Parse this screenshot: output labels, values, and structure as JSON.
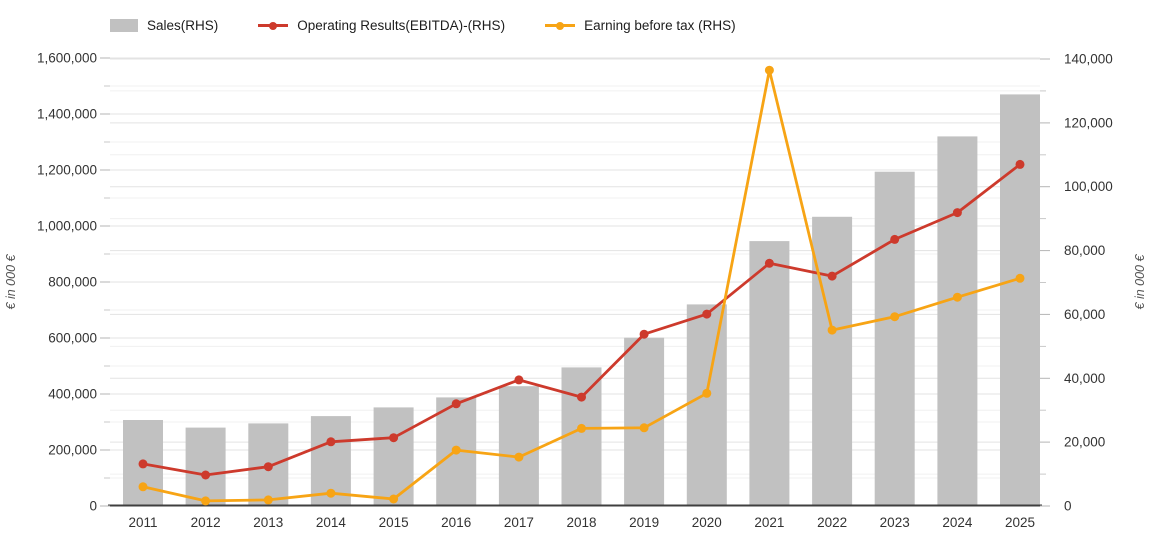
{
  "legend": {
    "items": [
      {
        "label": "Sales(RHS)",
        "marker": "bar-swatch-icon",
        "color": "#c1c1c1"
      },
      {
        "label": "Operating Results(EBITDA)-(RHS)",
        "marker": "line-dot-icon",
        "color": "#cd3a2c"
      },
      {
        "label": "Earning before tax (RHS)",
        "marker": "line-dot-icon",
        "color": "#f7a415"
      }
    ]
  },
  "chart_data": {
    "type": "bar+line",
    "categories": [
      "2011",
      "2012",
      "2013",
      "2014",
      "2015",
      "2016",
      "2017",
      "2018",
      "2019",
      "2020",
      "2021",
      "2022",
      "2023",
      "2024",
      "2025"
    ],
    "series": [
      {
        "name": "Sales(RHS)",
        "type": "bar",
        "axis": "left",
        "color": "#c1c1c1",
        "values": [
          307000,
          280000,
          295000,
          321000,
          352000,
          388000,
          428000,
          495000,
          601000,
          720000,
          946000,
          1033000,
          1194000,
          1320000,
          1470000
        ]
      },
      {
        "name": "Operating Results(EBITDA)-(RHS)",
        "type": "line",
        "axis": "right",
        "color": "#cd3a2c",
        "values": [
          13200,
          9700,
          12300,
          20100,
          21400,
          32000,
          39500,
          34100,
          53800,
          60100,
          76000,
          72000,
          83500,
          91900,
          107000
        ]
      },
      {
        "name": "Earning before tax (RHS)",
        "type": "line",
        "axis": "right",
        "color": "#f7a415",
        "values": [
          6000,
          1600,
          1900,
          4000,
          2200,
          17500,
          15300,
          24300,
          24500,
          35300,
          136500,
          55100,
          59300,
          65400,
          71300
        ]
      }
    ],
    "left_axis": {
      "title": "€ in 000 €",
      "min": 0,
      "max": 1600000,
      "major_step": 200000,
      "minor_step": 100000,
      "tick_labels": [
        "0",
        "200,000",
        "400,000",
        "600,000",
        "800,000",
        "1,000,000",
        "1,200,000",
        "1,400,000",
        "1,600,000"
      ]
    },
    "right_axis": {
      "title": "€ in 000 €",
      "min": 0,
      "max": 140000,
      "major_step": 20000,
      "minor_step": 10000,
      "tick_labels": [
        "0",
        "20,000",
        "40,000",
        "60,000",
        "80,000",
        "100,000",
        "120,000",
        "140,000"
      ]
    },
    "grid": true,
    "legend_position": "top-left"
  }
}
